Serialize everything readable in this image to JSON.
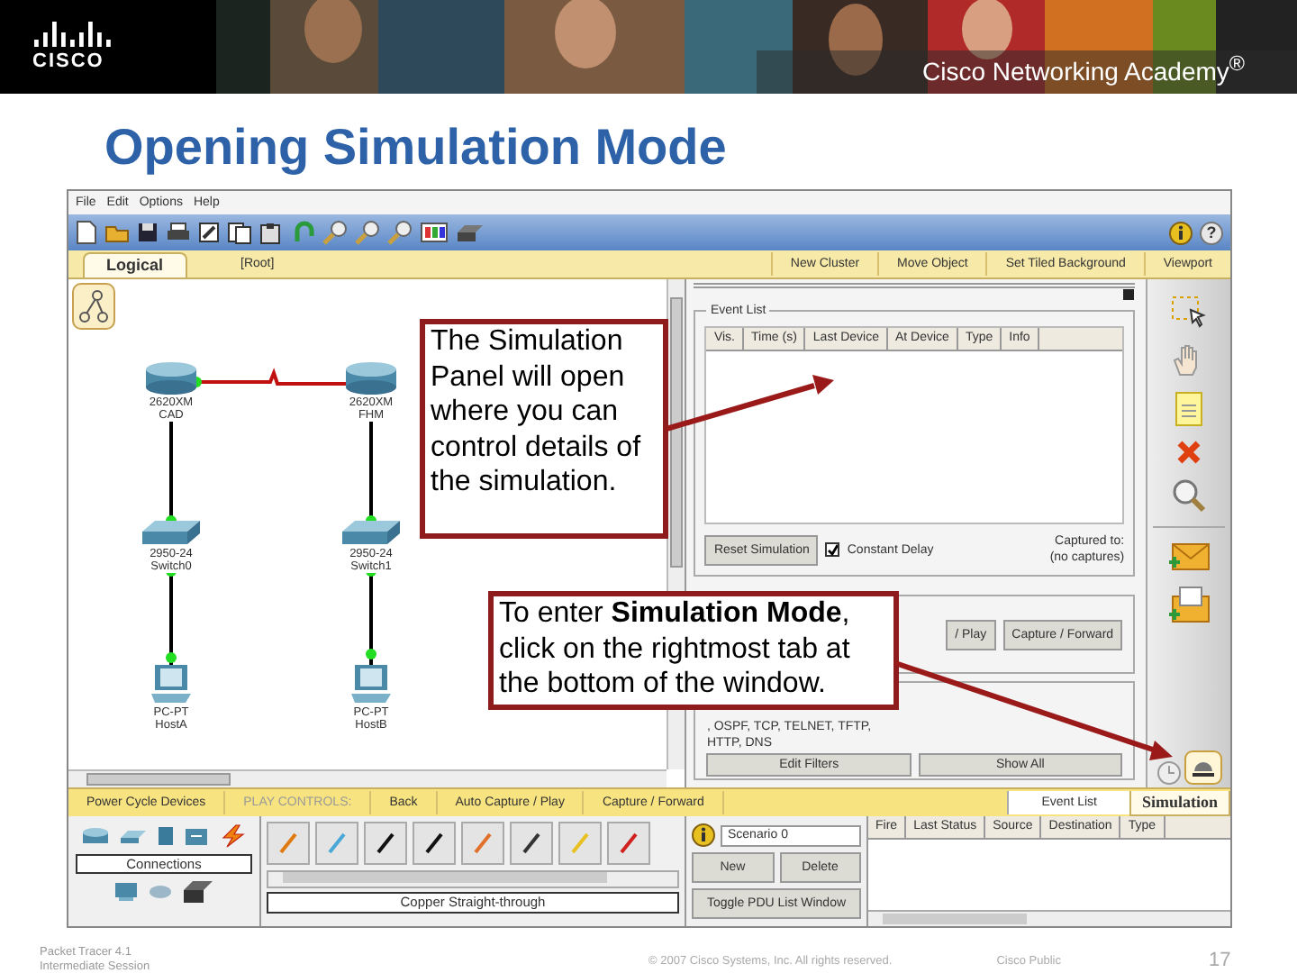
{
  "header": {
    "logo": "CISCO",
    "brand": "Cisco Networking Academy$^{®}$"
  },
  "slide_title": "Opening Simulation Mode",
  "app": {
    "menu": [
      "File",
      "Edit",
      "Options",
      "Help"
    ],
    "toolbar": {
      "help": "?"
    },
    "workspace_bar": {
      "tab": {
        "label": "Logical",
        "selected": true
      },
      "path": "[Root]",
      "actions": [
        "New Cluster",
        "Move Object",
        "Set Tiled Background",
        "Viewport"
      ]
    },
    "devices": [
      {
        "kind": "router",
        "model": "2620XM",
        "name": "CAD"
      },
      {
        "kind": "router",
        "model": "2620XM",
        "name": "FHM"
      },
      {
        "kind": "switch",
        "model": "2950-24",
        "name": "Switch0"
      },
      {
        "kind": "switch",
        "model": "2950-24",
        "name": "Switch1"
      },
      {
        "kind": "pc",
        "model": "PC-PT",
        "name": "HostA"
      },
      {
        "kind": "pc",
        "model": "PC-PT",
        "name": "HostB"
      }
    ],
    "sim_panel": {
      "event_list": {
        "legend": "Event List",
        "columns": [
          "Vis.",
          "Time (s)",
          "Last Device",
          "At Device",
          "Type",
          "Info"
        ]
      },
      "reset_button": "Reset Simulation",
      "constant_delay": {
        "label": "Constant Delay",
        "checked": true
      },
      "captured_label": "Captured to:",
      "captured_value": "(no captures)",
      "play_buttons": [
        "/ Play",
        "Capture / Forward"
      ],
      "filter_lines": [
        ", OSPF, TCP, TELNET, TFTP,",
        "HTTP, DNS"
      ],
      "filter_buttons": [
        "Edit Filters",
        "Show All"
      ]
    },
    "play_bar": {
      "items": [
        "Power Cycle Devices",
        "PLAY CONTROLS:",
        "Back",
        "Auto Capture / Play",
        "Capture / Forward"
      ],
      "event_list_button": "Event List",
      "mode_tab": {
        "label": "Simulation",
        "selected": true
      }
    },
    "device_panel": {
      "category": "Connections",
      "cable_caption": "Copper Straight-through"
    },
    "pdu_panel": {
      "scenario": "Scenario 0",
      "buttons": [
        "New",
        "Delete"
      ],
      "toggle_button": "Toggle PDU List Window",
      "columns": [
        "Fire",
        "Last Status",
        "Source",
        "Destination",
        "Type"
      ]
    }
  },
  "callouts": [
    {
      "text": "The Simulation Panel will open where you can control details of the simulation."
    },
    {
      "text": "To enter **Simulation Mode**, click on the rightmost tab at the bottom of the window."
    }
  ],
  "footer": {
    "course": "Packet Tracer 4.1 Intermediate Session",
    "copyright": "© 2007 Cisco Systems, Inc. All rights reserved.",
    "classification": "Cisco Public",
    "page": "17"
  }
}
